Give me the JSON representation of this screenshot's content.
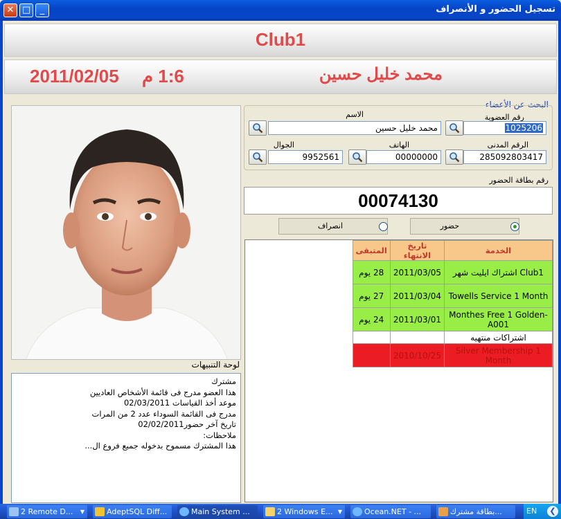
{
  "window": {
    "title": "تسجيل الحضور و الأنصراف",
    "close_glyph": "✕",
    "max_glyph": "□",
    "min_glyph": "_"
  },
  "header": {
    "club_name": "Club1",
    "time": "1:6 م",
    "date": "2011/02/05",
    "member_name": "محمد خليل   حسين"
  },
  "alerts": {
    "label": "لوحة التنبيهات",
    "lines": [
      "مشترك",
      "هذا العضو مدرج فى قائمة الأشخاص العاديين",
      "موعد أخذ القياسات 02/03/2011",
      "مدرج فى القائمة السوداء عدد 2  من المرات",
      "تاريخ آخر حضور02/02/2011",
      "ملاحظات:",
      "هذا المشترك مسموح بدخوله جميع فروع ال..."
    ]
  },
  "search": {
    "title": "البحث عن الأعضاء",
    "membership_label": "رقم العضوية",
    "membership_value": "1025206",
    "name_label": "الاسم",
    "name_value": "محمد خليل   حسين",
    "civil_label": "الرقم المدنى",
    "civil_value": "285092803417",
    "phone_label": "الهاتف",
    "phone_value": "00000000",
    "mobile_label": "الجوال",
    "mobile_value": "9952561"
  },
  "attendance": {
    "card_label": "رقم بطاقة الحضور",
    "card_number": "00074130",
    "check_in_label": "حضور",
    "check_out_label": "انصراف",
    "selected": "check_in"
  },
  "subscriptions": {
    "columns": [
      "الخدمة",
      "تاريخ الانتهاء",
      "المتبقى"
    ],
    "active": [
      {
        "service": "اشتراك ايليت شهر Club1",
        "end_date": "2011/03/05",
        "remaining": "28 يوم"
      },
      {
        "service": "Towells Service 1 Month",
        "end_date": "2011/03/04",
        "remaining": "27 يوم"
      },
      {
        "service": "Monthes Free 1 Golden-A001",
        "end_date": "2011/03/01",
        "remaining": "24 يوم"
      }
    ],
    "expired_label": "اشتراكات منتهيه",
    "expired": [
      {
        "service": "Silver Membership 1 Month",
        "end_date": "2010/10/25",
        "remaining": ""
      }
    ]
  },
  "taskbar": {
    "items": [
      {
        "label": "2 Remote D...",
        "icon": "remote-desktop-icon"
      },
      {
        "label": "AdeptSQL Diff...",
        "icon": "adeptsql-icon"
      },
      {
        "label": "Main System ...",
        "icon": "globe-icon"
      },
      {
        "label": "2 Windows E...",
        "icon": "folder-icon"
      },
      {
        "label": "Ocean.NET - ...",
        "icon": "globe-icon"
      },
      {
        "label": "بطاقة مشترك...",
        "icon": "app-icon"
      }
    ],
    "language": "EN"
  },
  "colors": {
    "accent_red": "#e04a4a",
    "active_row": "#98ee47",
    "expired_row": "#ec1c24",
    "header_row": "#f8c88a",
    "title_blue": "#0846c9"
  }
}
